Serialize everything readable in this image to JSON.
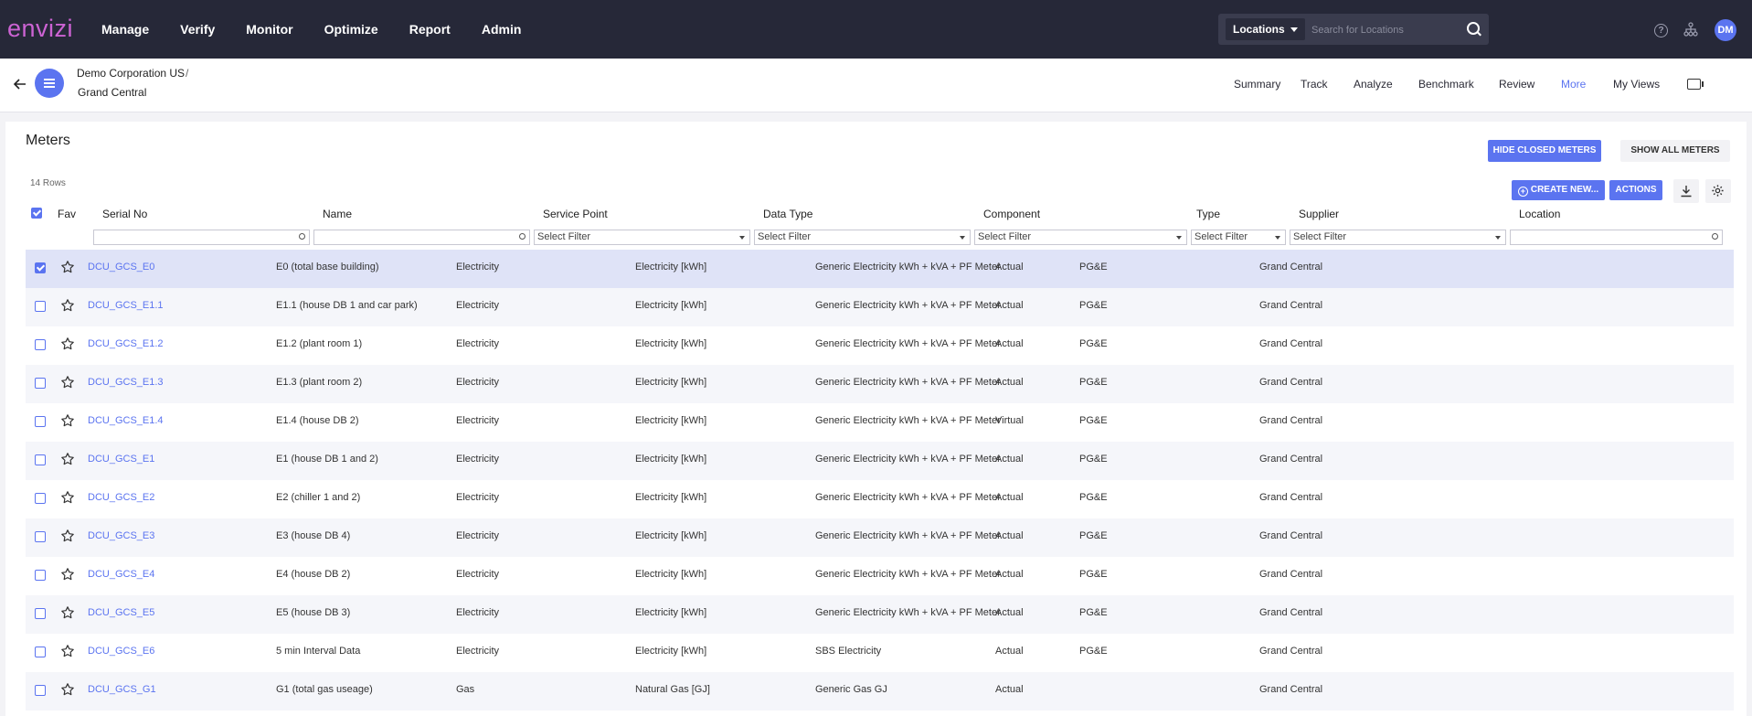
{
  "app": {
    "logo": "envizi",
    "nav": [
      "Manage",
      "Verify",
      "Monitor",
      "Optimize",
      "Report",
      "Admin"
    ],
    "search": {
      "selector": "Locations",
      "placeholder": "Search for Locations"
    },
    "avatar": "DM"
  },
  "breadcrumb": {
    "org": "Demo Corporation US",
    "separator": "/",
    "location": "Grand Central"
  },
  "view_tabs": [
    "Summary",
    "Track",
    "Analyze",
    "Benchmark",
    "Review",
    "More",
    "My Views"
  ],
  "page": {
    "title": "Meters",
    "hide_closed": "HIDE CLOSED METERS",
    "show_all": "SHOW ALL METERS",
    "row_count": "14 Rows",
    "create_new": "CREATE NEW...",
    "actions": "ACTIONS"
  },
  "table": {
    "headers": [
      "Fav",
      "Serial No",
      "Name",
      "Service Point",
      "Data Type",
      "Component",
      "Type",
      "Supplier",
      "Location"
    ],
    "filter_placeholder": "Select Filter",
    "rows": [
      {
        "serial": "DCU_GCS_E0",
        "name": "E0 (total base building)",
        "service": "Electricity",
        "dtype": "Electricity [kWh]",
        "component": "Generic Electricity kWh + kVA + PF Meter",
        "type": "Actual",
        "supplier": "PG&E",
        "location": "Grand Central"
      },
      {
        "serial": "DCU_GCS_E1.1",
        "name": "E1.1 (house DB 1 and car park)",
        "service": "Electricity",
        "dtype": "Electricity [kWh]",
        "component": "Generic Electricity kWh + kVA + PF Meter",
        "type": "Actual",
        "supplier": "PG&E",
        "location": "Grand Central"
      },
      {
        "serial": "DCU_GCS_E1.2",
        "name": "E1.2 (plant room 1)",
        "service": "Electricity",
        "dtype": "Electricity [kWh]",
        "component": "Generic Electricity kWh + kVA + PF Meter",
        "type": "Actual",
        "supplier": "PG&E",
        "location": "Grand Central"
      },
      {
        "serial": "DCU_GCS_E1.3",
        "name": "E1.3 (plant room 2)",
        "service": "Electricity",
        "dtype": "Electricity [kWh]",
        "component": "Generic Electricity kWh + kVA + PF Meter",
        "type": "Actual",
        "supplier": "PG&E",
        "location": "Grand Central"
      },
      {
        "serial": "DCU_GCS_E1.4",
        "name": "E1.4 (house DB 2)",
        "service": "Electricity",
        "dtype": "Electricity [kWh]",
        "component": "Generic Electricity kWh + kVA + PF Meter",
        "type": "Virtual",
        "supplier": "PG&E",
        "location": "Grand Central"
      },
      {
        "serial": "DCU_GCS_E1",
        "name": "E1 (house DB 1 and 2)",
        "service": "Electricity",
        "dtype": "Electricity [kWh]",
        "component": "Generic Electricity kWh + kVA + PF Meter",
        "type": "Actual",
        "supplier": "PG&E",
        "location": "Grand Central"
      },
      {
        "serial": "DCU_GCS_E2",
        "name": "E2 (chiller 1 and 2)",
        "service": "Electricity",
        "dtype": "Electricity [kWh]",
        "component": "Generic Electricity kWh + kVA + PF Meter",
        "type": "Actual",
        "supplier": "PG&E",
        "location": "Grand Central"
      },
      {
        "serial": "DCU_GCS_E3",
        "name": "E3 (house DB 4)",
        "service": "Electricity",
        "dtype": "Electricity [kWh]",
        "component": "Generic Electricity kWh + kVA + PF Meter",
        "type": "Actual",
        "supplier": "PG&E",
        "location": "Grand Central"
      },
      {
        "serial": "DCU_GCS_E4",
        "name": "E4 (house DB 2)",
        "service": "Electricity",
        "dtype": "Electricity [kWh]",
        "component": "Generic Electricity kWh + kVA + PF Meter",
        "type": "Actual",
        "supplier": "PG&E",
        "location": "Grand Central"
      },
      {
        "serial": "DCU_GCS_E5",
        "name": "E5 (house DB 3)",
        "service": "Electricity",
        "dtype": "Electricity [kWh]",
        "component": "Generic Electricity kWh + kVA + PF Meter",
        "type": "Actual",
        "supplier": "PG&E",
        "location": "Grand Central"
      },
      {
        "serial": "DCU_GCS_E6",
        "name": "5 min Interval Data",
        "service": "Electricity",
        "dtype": "Electricity [kWh]",
        "component": "SBS Electricity",
        "type": "Actual",
        "supplier": "PG&E",
        "location": "Grand Central"
      },
      {
        "serial": "DCU_GCS_G1",
        "name": "G1 (total gas useage)",
        "service": "Gas",
        "dtype": "Natural Gas [GJ]",
        "component": "Generic Gas GJ",
        "type": "Actual",
        "supplier": "",
        "location": "Grand Central"
      }
    ],
    "selected_rows": [
      0
    ]
  },
  "colors": {
    "topbar": "#262838",
    "accent": "#5b74f0",
    "logo": "#cc63d3",
    "selected_row": "#dfe3f7"
  }
}
